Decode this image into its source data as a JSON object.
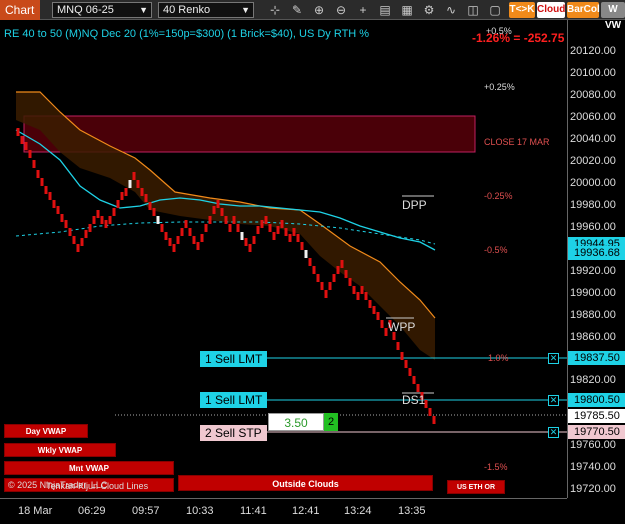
{
  "toolbar": {
    "chart_tab": "Chart",
    "instrument": "MNQ 06-25",
    "bar_type": "40 Renko",
    "buttons": {
      "tck": "T<>K",
      "cloud": "Cloud",
      "barcol": "BarCol",
      "w_vw": "W VW"
    }
  },
  "chart": {
    "title": "RE 40 to 50 (M)NQ Dec 20 (1%=150p=$300) (1 Brick=$40), US Dy RTH %",
    "pnl": "-1.26% = -252.75",
    "close_label": "CLOSE 17 MAR",
    "pct_labels": [
      "+0.5%",
      "+0.25%",
      "-0.25%",
      "-0.5%",
      "1.0%",
      "-1.5%"
    ],
    "pivot_labels": {
      "dpp": "DPP",
      "wpp": "WPP",
      "ds1": "DS1"
    },
    "vwap_labels": [
      "Day VWAP",
      "Wkly VWAP",
      "Mnt VWAP"
    ],
    "clouds_label": "Outside Clouds",
    "session_label": "US ETH OR",
    "footer_text": "© 2025 NinjaTrader, LLC",
    "footer_text2": "Tenkan-Kijun Cloud Lines"
  },
  "orders": [
    {
      "label": "1 Sell LMT",
      "price": "19837.50",
      "color": "#1ed2e6"
    },
    {
      "label": "1 Sell LMT",
      "price": "19800.50",
      "color": "#1ed2e6"
    },
    {
      "label": "2 Sell STP",
      "price": "19770.50",
      "color": "#f0c8d0"
    }
  ],
  "position": {
    "avg_price": "3.50",
    "quantity": "2"
  },
  "price_axis": {
    "ticks": [
      "20120.00",
      "20100.00",
      "20080.00",
      "20060.00",
      "20040.00",
      "20020.00",
      "20000.00",
      "19980.00",
      "19960.00",
      "19920.00",
      "19900.00",
      "19880.00",
      "19860.00",
      "19820.00",
      "19760.00",
      "19740.00",
      "19720.00"
    ],
    "tags": [
      {
        "text": "19944.95",
        "bg": "#1ed2e6"
      },
      {
        "text": "19936.68",
        "bg": "#1ed2e6"
      },
      {
        "text": "19837.50",
        "bg": "#1ed2e6"
      },
      {
        "text": "19800.50",
        "bg": "#1ed2e6"
      },
      {
        "text": "19785.50",
        "bg": "#ffffff"
      },
      {
        "text": "19770.50",
        "bg": "#f0c8d0"
      }
    ]
  },
  "time_axis": [
    "18 Mar",
    "06:29",
    "09:57",
    "10:33",
    "11:41",
    "12:41",
    "13:24",
    "13:35"
  ]
}
